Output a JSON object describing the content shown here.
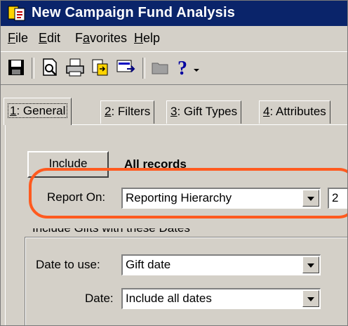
{
  "window": {
    "title": "New Campaign Fund Analysis",
    "app_icon": "campaign-report-icon"
  },
  "menu": [
    {
      "first": "F",
      "rest": "ile"
    },
    {
      "first": "E",
      "rest": "dit"
    },
    {
      "first": "",
      "mid_pre": "F",
      "mid_u": "a",
      "rest": "vorites"
    },
    {
      "first": "H",
      "rest": "elp"
    }
  ],
  "toolbar": {
    "icons": [
      "save-icon",
      "print-preview-icon",
      "print-icon",
      "export-icon",
      "send-icon",
      "folder-icon",
      "help-icon"
    ],
    "help_glyph": "?"
  },
  "tabs": [
    {
      "num": "1",
      "label": ": General",
      "active": true
    },
    {
      "num": "2",
      "label": ": Filters",
      "active": false
    },
    {
      "num": "3",
      "label": ": Gift Types",
      "active": false
    },
    {
      "num": "4",
      "label": ": Attributes",
      "active": false
    }
  ],
  "general": {
    "include_button": {
      "first": "I",
      "rest": "nclude"
    },
    "include_value": "All records",
    "report_on": {
      "label": "Report On:",
      "value": "Reporting Hierarchy",
      "side_value": "2"
    },
    "dates_group": {
      "title": "Include Gifts with these Dates",
      "date_to_use": {
        "label": "Date to use:",
        "value": "Gift date"
      },
      "date": {
        "label": "Date:",
        "value": "Include all dates"
      }
    }
  },
  "colors": {
    "titlebar": "#0a246a",
    "face": "#d4d0c8",
    "highlight_ring": "#ff5a1f"
  }
}
